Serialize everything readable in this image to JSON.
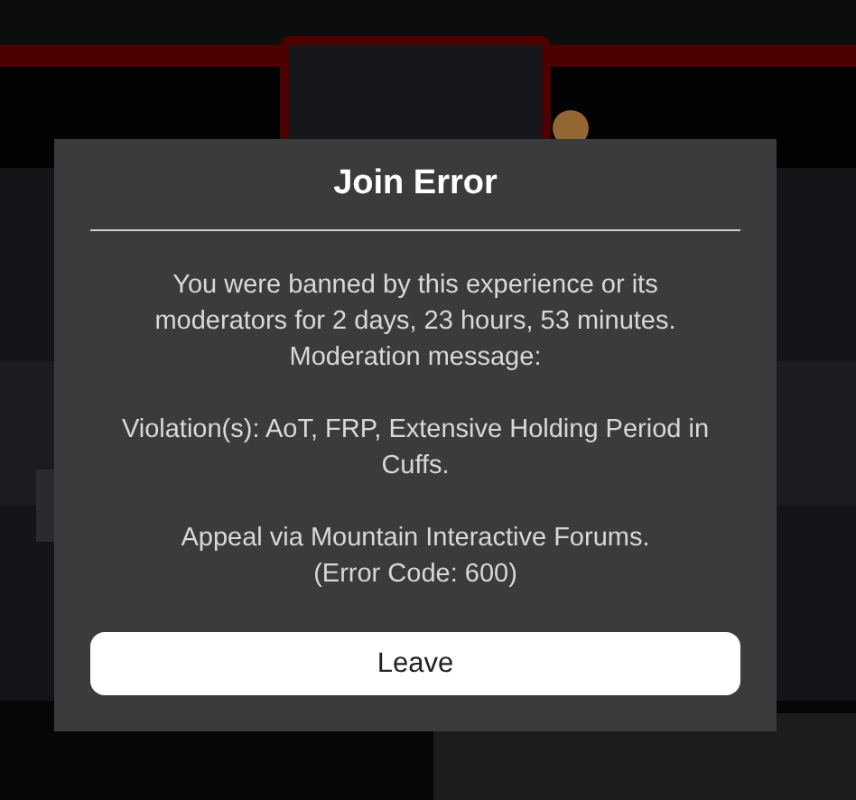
{
  "dialog": {
    "title": "Join Error",
    "message": [
      [
        "You were banned by this experience or its moderators for 2 days, 23 hours, 53 minutes.",
        "Moderation message:"
      ],
      [
        "Violation(s): AoT, FRP, Extensive Holding Period in Cuffs."
      ],
      [
        "Appeal via Mountain Interactive Forums.",
        "(Error Code: 600)"
      ]
    ],
    "buttons": [
      {
        "label": "Leave"
      }
    ]
  }
}
